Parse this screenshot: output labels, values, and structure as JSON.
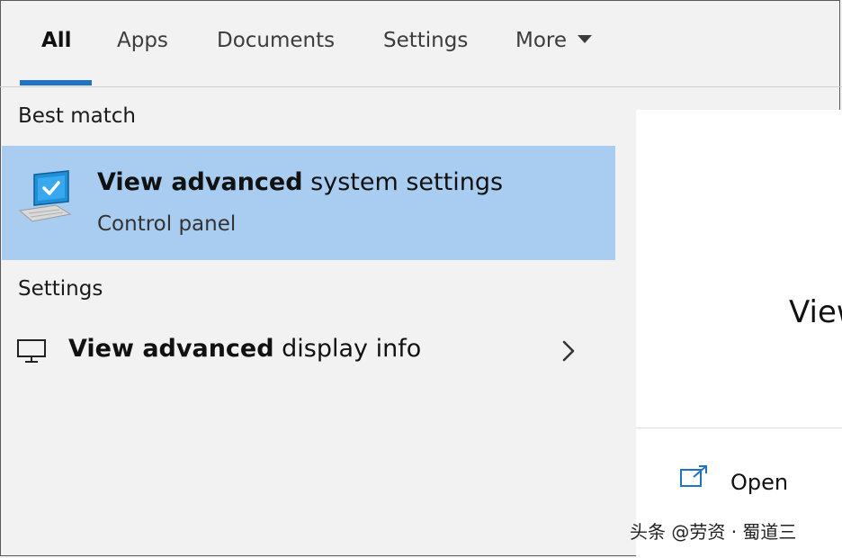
{
  "tabs": [
    {
      "label": "All",
      "active": true
    },
    {
      "label": "Apps"
    },
    {
      "label": "Documents"
    },
    {
      "label": "Settings"
    },
    {
      "label": "More"
    }
  ],
  "best_match": {
    "section_label": "Best match",
    "title_bold": "View advanced",
    "title_rest": " system settings",
    "subtitle": "Control panel",
    "icon": "computer-settings-icon",
    "highlight_color": "#a9cdf0"
  },
  "settings": {
    "section_label": "Settings",
    "item": {
      "title_bold": "View advanced",
      "title_rest": " display info",
      "icon": "monitor-icon"
    }
  },
  "preview": {
    "title": "View",
    "open_label": "Open"
  },
  "watermark": "头条 @劳资 · 蜀道三",
  "colors": {
    "accent": "#1f72c4"
  }
}
